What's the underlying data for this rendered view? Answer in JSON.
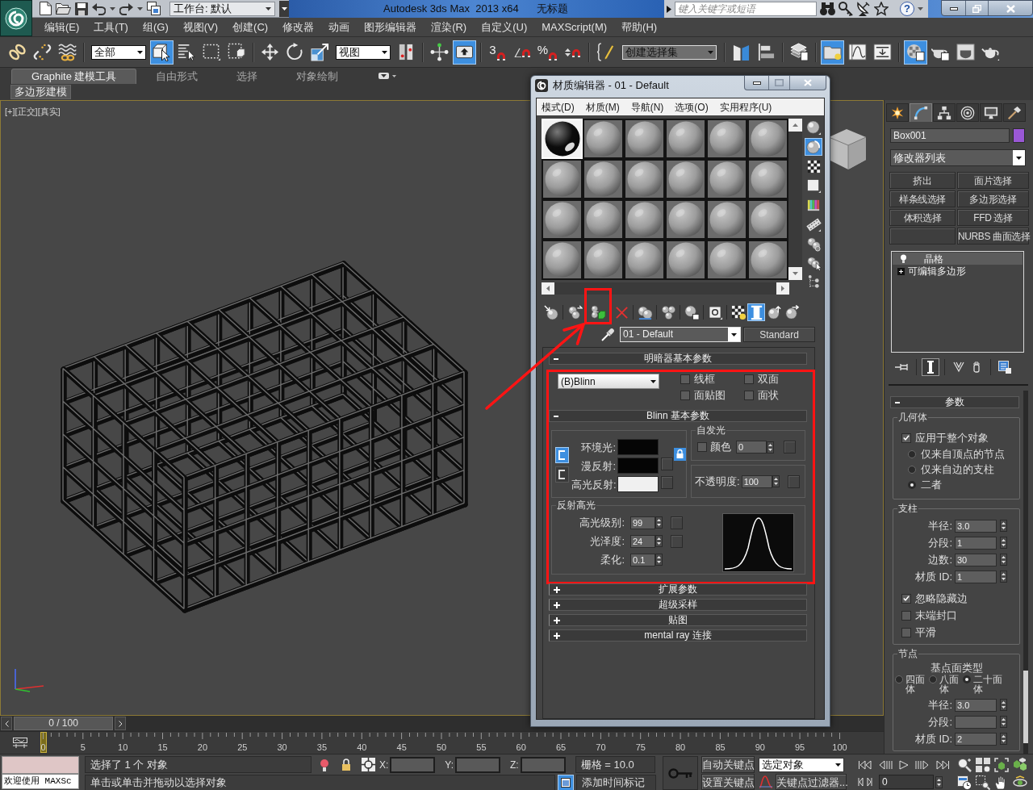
{
  "title_bar": {
    "workspace": "工作台: 默认",
    "app_title": "Autodesk 3ds Max  2013 x64",
    "document": "无标题",
    "search": {
      "placeholder": "键入关键字或短语"
    },
    "help": "?"
  },
  "menu_bar": [
    "编辑(E)",
    "工具(T)",
    "组(G)",
    "视图(V)",
    "创建(C)",
    "修改器",
    "动画",
    "图形编辑器",
    "渲染(R)",
    "自定义(U)",
    "MAXScript(M)",
    "帮助(H)"
  ],
  "main_toolbar": {
    "selection_filter": "全部",
    "reference_coordinate_system": "视图",
    "named_selection_set": "创建选择集",
    "tools": [
      {
        "selected": false
      },
      {
        "selected": false
      },
      {
        "selected": false
      },
      {
        "selected": true
      },
      {
        "selected": false
      },
      {
        "selected": false
      },
      {
        "selected": false
      },
      {
        "selected": false
      },
      {
        "selected": false
      },
      {
        "selected": false
      },
      {
        "selected": false
      },
      {
        "selected": false
      },
      {
        "selected": true
      },
      {
        "selected": false,
        "label": "3"
      },
      {
        "selected": false
      },
      {
        "selected": false,
        "label": "%"
      },
      {
        "selected": false
      },
      {
        "selected": false
      },
      {
        "selected": false
      },
      {
        "selected": false
      },
      {
        "selected": false
      },
      {
        "selected": true
      },
      {
        "selected": false
      },
      {
        "selected": false
      },
      {
        "selected": true
      },
      {
        "selected": false
      },
      {
        "selected": false
      },
      {
        "selected": false
      }
    ]
  },
  "ribbon": {
    "tabs": [
      {
        "label": "Graphite 建模工具",
        "selected": true
      },
      {
        "label": "自由形式",
        "selected": false
      },
      {
        "label": "选择",
        "selected": false
      },
      {
        "label": "对象绘制",
        "selected": false
      }
    ],
    "panel": "多边形建模"
  },
  "viewport": {
    "label": "[+][正交][真实]"
  },
  "material_editor": {
    "title": "材质编辑器 - 01 - Default",
    "menus": [
      "模式(D)",
      "材质(M)",
      "导航(N)",
      "选项(O)",
      "实用程序(U)"
    ],
    "slots": [
      {
        "selected": true,
        "color": "#0c0c0c"
      },
      {
        "selected": false,
        "color": "#9c9c9c"
      },
      {
        "selected": false,
        "color": "#9c9c9c"
      },
      {
        "selected": false,
        "color": "#9c9c9c"
      },
      {
        "selected": false,
        "color": "#9c9c9c"
      },
      {
        "selected": false,
        "color": "#9c9c9c"
      },
      {
        "selected": false,
        "color": "#9c9c9c"
      },
      {
        "selected": false,
        "color": "#9c9c9c"
      },
      {
        "selected": false,
        "color": "#9c9c9c"
      },
      {
        "selected": false,
        "color": "#9c9c9c"
      },
      {
        "selected": false,
        "color": "#9c9c9c"
      },
      {
        "selected": false,
        "color": "#9c9c9c"
      },
      {
        "selected": false,
        "color": "#9c9c9c"
      },
      {
        "selected": false,
        "color": "#9c9c9c"
      },
      {
        "selected": false,
        "color": "#9c9c9c"
      },
      {
        "selected": false,
        "color": "#9c9c9c"
      },
      {
        "selected": false,
        "color": "#9c9c9c"
      },
      {
        "selected": false,
        "color": "#9c9c9c"
      },
      {
        "selected": false,
        "color": "#9c9c9c"
      },
      {
        "selected": false,
        "color": "#9c9c9c"
      },
      {
        "selected": false,
        "color": "#9c9c9c"
      },
      {
        "selected": false,
        "color": "#9c9c9c"
      },
      {
        "selected": false,
        "color": "#9c9c9c"
      },
      {
        "selected": false,
        "color": "#9c9c9c"
      }
    ],
    "backlight": true,
    "tools": [
      {
        "selected": false,
        "highlighted": false
      },
      {
        "selected": false,
        "highlighted": false
      },
      {
        "selected": false,
        "highlighted": true
      },
      {
        "selected": false,
        "highlighted": false
      },
      {
        "selected": false,
        "highlighted": false
      },
      {
        "selected": false,
        "highlighted": false
      },
      {
        "selected": false,
        "highlighted": false
      },
      {
        "selected": false,
        "highlighted": false
      },
      {
        "selected": false,
        "highlighted": false
      },
      {
        "selected": true,
        "highlighted": false
      },
      {
        "selected": false,
        "highlighted": false
      },
      {
        "selected": false,
        "highlighted": false
      }
    ],
    "material_name": "01 - Default",
    "material_type": "Standard",
    "rollouts": [
      {
        "kind": "shader",
        "title": "明暗器基本参数",
        "expanded": true,
        "highlighted": true,
        "shader": "(B)Blinn",
        "options": [
          {
            "label": "线框",
            "checked": false
          },
          {
            "label": "双面",
            "checked": false
          },
          {
            "label": "面贴图",
            "checked": false
          },
          {
            "label": "面状",
            "checked": false
          }
        ]
      },
      {
        "kind": "blinn",
        "title": "Blinn 基本参数",
        "expanded": true,
        "highlighted": true,
        "colors": [
          {
            "label": "环境光:",
            "color": "#050505"
          },
          {
            "label": "漫反射:",
            "color": "#050505"
          },
          {
            "label": "高光反射:",
            "color": "#f0f0f0"
          }
        ],
        "self_illumination": {
          "title": "自发光",
          "label": "颜色",
          "checked": false,
          "value": "0"
        },
        "opacity": {
          "label": "不透明度:",
          "value": "100"
        },
        "specular": {
          "title": "反射高光",
          "fields": [
            {
              "label": "高光级别:",
              "value": "99"
            },
            {
              "label": "光泽度:",
              "value": "24"
            },
            {
              "label": "柔化:",
              "value": "0.1"
            }
          ]
        }
      },
      {
        "kind": "collapsed",
        "title": "扩展参数",
        "expanded": false,
        "highlighted": false
      },
      {
        "kind": "collapsed",
        "title": "超级采样",
        "expanded": false,
        "highlighted": false
      },
      {
        "kind": "collapsed",
        "title": "贴图",
        "expanded": false,
        "highlighted": false
      },
      {
        "kind": "collapsed",
        "title": "mental ray 连接",
        "expanded": false,
        "highlighted": false
      }
    ]
  },
  "annotations": {
    "arrow": true
  },
  "command_panel": {
    "tabs": [
      {
        "selected": false
      },
      {
        "selected": true
      },
      {
        "selected": false
      },
      {
        "selected": false
      },
      {
        "selected": false
      },
      {
        "selected": false
      }
    ],
    "object": {
      "name": "Box001",
      "color": "#9a58d6"
    },
    "modifier_list": "修改器列表",
    "modifier_buttons": [
      {
        "kind": "button",
        "label": "挤出"
      },
      {
        "kind": "button",
        "label": "面片选择"
      },
      {
        "kind": "button",
        "label": "样条线选择"
      },
      {
        "kind": "button",
        "label": "多边形选择"
      },
      {
        "kind": "button",
        "label": "体积选择"
      },
      {
        "kind": "button",
        "label": "FFD 选择"
      },
      {
        "kind": "blank"
      },
      {
        "kind": "button",
        "label": "NURBS 曲面选择"
      }
    ],
    "stack": [
      {
        "kind": "modifier",
        "label": "晶格",
        "selected": true
      },
      {
        "kind": "object",
        "label": "可编辑多边形",
        "selected": false
      }
    ],
    "stack_tools": [
      {
        "selected": false
      },
      {
        "selected": true
      },
      {
        "selected": false
      },
      {
        "selected": false
      },
      {
        "selected": false
      }
    ],
    "rollout": {
      "title": "参数",
      "expanded": true,
      "groups": [
        {
          "title": "几何体",
          "items": [
            {
              "kind": "checkbox",
              "label": "应用于整个对象",
              "checked": true
            },
            {
              "kind": "radio",
              "label": "仅来自顶点的节点",
              "selected": false
            },
            {
              "kind": "radio",
              "label": "仅来自边的支柱",
              "selected": false
            },
            {
              "kind": "radio",
              "label": "二者",
              "selected": true
            }
          ]
        },
        {
          "title": "支柱",
          "items": [
            {
              "kind": "spinner",
              "label": "半径:",
              "value": "3.0"
            },
            {
              "kind": "spinner",
              "label": "分段:",
              "value": "1"
            },
            {
              "kind": "spinner",
              "label": "边数:",
              "value": "30"
            },
            {
              "kind": "spinner",
              "label": "材质 ID:",
              "value": "1"
            },
            {
              "kind": "checkbox",
              "label": "忽略隐藏边",
              "checked": true
            },
            {
              "kind": "checkbox",
              "label": "末端封口",
              "checked": false
            },
            {
              "kind": "checkbox",
              "label": "平滑",
              "checked": false
            }
          ]
        },
        {
          "title": "节点",
          "items": [
            {
              "kind": "caption",
              "label": "基点面类型"
            },
            {
              "kind": "radio_row",
              "options": [
                {
                  "label": "四面体",
                  "selected": false
                },
                {
                  "label": "八面体",
                  "selected": false
                },
                {
                  "label": "二十面体",
                  "selected": true
                }
              ]
            },
            {
              "kind": "spinner",
              "label": "半径:",
              "value": "3.0"
            },
            {
              "kind": "spinner",
              "label": "分段:"
            },
            {
              "kind": "spinner",
              "label": "材质 ID:",
              "value": "2"
            }
          ]
        }
      ]
    }
  },
  "time_slider": {
    "position": "0 / 100",
    "level": 0,
    "frame_labels": [
      "0",
      "5",
      "10",
      "15",
      "20",
      "25",
      "30",
      "35",
      "40",
      "45",
      "50",
      "55",
      "60",
      "65",
      "70",
      "75",
      "80",
      "85",
      "90",
      "95",
      "100"
    ]
  },
  "status_bar": {
    "listener": "欢迎使用 MAXSc",
    "prompt": "选择了 1 个 对象",
    "hint": "单击或单击并拖动以选择对象",
    "coordinates": [
      "X:",
      "Y:",
      "Z:"
    ],
    "grid": "栅格 = 10.0",
    "time_tag": "添加时间标记",
    "auto_key": "自动关键点",
    "key_set": "选定对象",
    "set_key": "设置关键点",
    "key_filters": "关键点过滤器...",
    "current_frame": "0"
  }
}
